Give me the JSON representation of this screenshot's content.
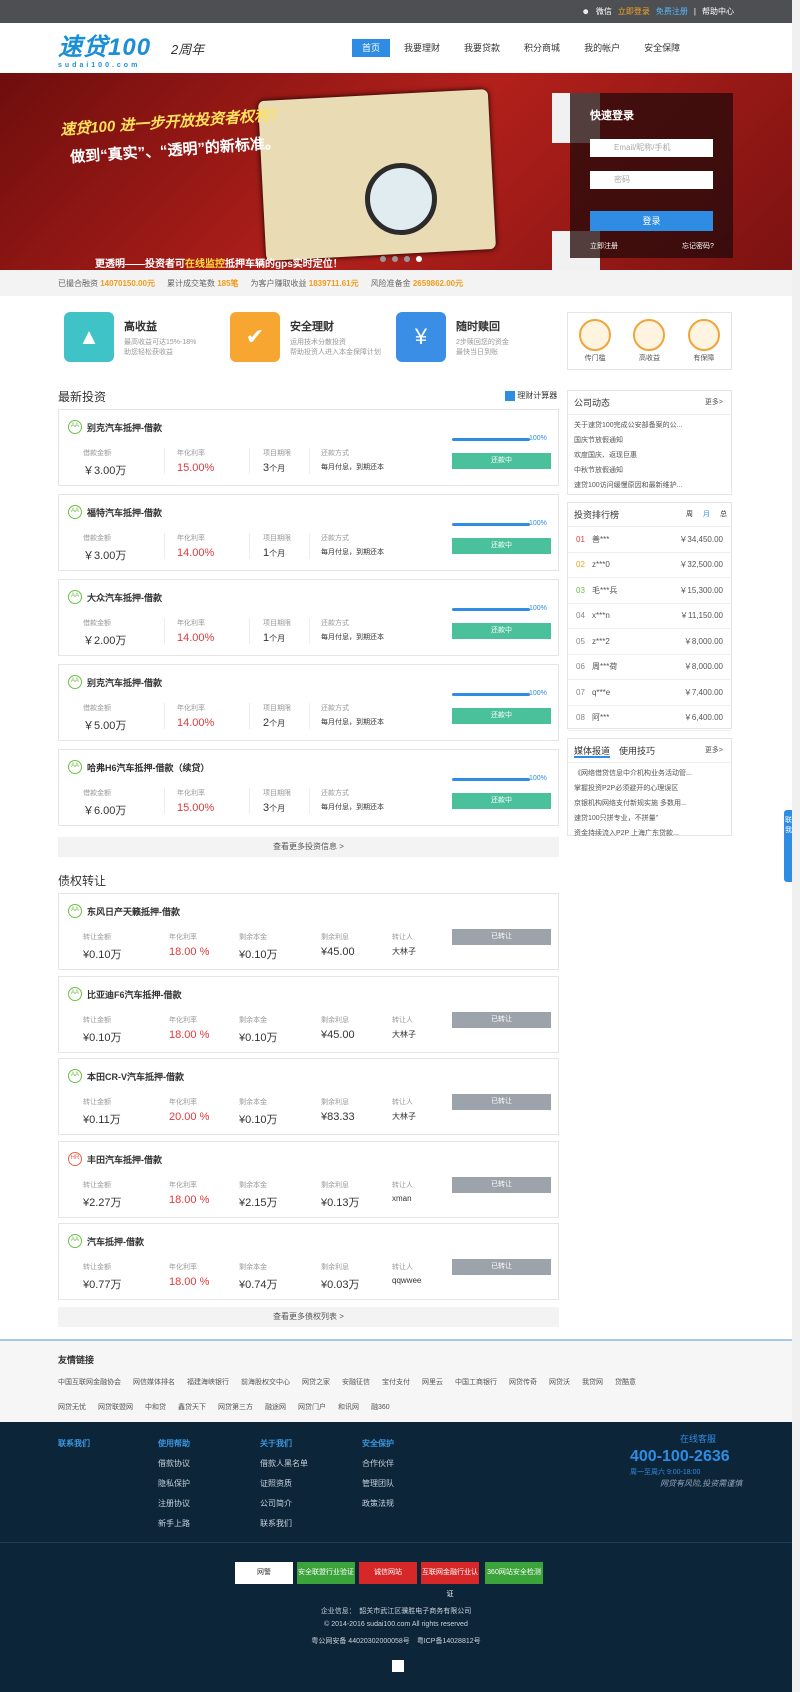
{
  "topbar": {
    "weixin": "微信",
    "login": "立即登录",
    "register": "免费注册",
    "help": "帮助中心"
  },
  "header": {
    "logo": "速贷100",
    "logo_sub": "sudai100.com",
    "anniversary": "2周年",
    "nav": [
      "首页",
      "我要理财",
      "我要贷款",
      "积分商城",
      "我的帐户",
      "安全保障"
    ]
  },
  "banner": {
    "line1": "速贷100 进一步开放投资者权利！",
    "line2": "做到“真实”、“透明”的新标准。",
    "line3a": "更透明——投资者可",
    "line3b": "在线监控",
    "line3c": "抵押车辆的gps实时定位！",
    "login_title": "快速登录",
    "user_ph": "Email/昵称/手机",
    "pwd_ph": "密码",
    "login_btn": "登录",
    "reg_link": "立即注册",
    "forgot": "忘记密码?"
  },
  "stats": [
    {
      "label": "已撮合融资",
      "value": "14070150.00元"
    },
    {
      "label": "累计成交笔数",
      "value": "185笔"
    },
    {
      "label": "为客户赚取收益",
      "value": "1839711.61元"
    },
    {
      "label": "风险准备金",
      "value": "2659862.00元"
    }
  ],
  "features": [
    {
      "title": "高收益",
      "d1": "最高收益可达15%-18%",
      "d2": "助您轻松获收益"
    },
    {
      "title": "安全理财",
      "d1": "运用技术分散投资",
      "d2": "帮助投资人进入本金保障计划"
    },
    {
      "title": "随时赎回",
      "d1": "2步赎回您的资金",
      "d2": "最快当日到账"
    }
  ],
  "badges": [
    "传门槛",
    "高收益",
    "有保障"
  ],
  "invest": {
    "title": "最新投资",
    "calc": "理财计算器",
    "more": "查看更多投资信息 >",
    "labels": {
      "amount": "借款金额",
      "rate": "年化利率",
      "term": "项目期限",
      "repay": "还款方式"
    },
    "items": [
      {
        "name": "别克汽车抵押-借款",
        "amount": "￥3.00万",
        "rate": "15.00%",
        "term": "3",
        "unit": "个月",
        "repay": "每月付息，到期还本",
        "pct": "100%",
        "status": "还款中"
      },
      {
        "name": "福特汽车抵押-借款",
        "amount": "￥3.00万",
        "rate": "14.00%",
        "term": "1",
        "unit": "个月",
        "repay": "每月付息，到期还本",
        "pct": "100%",
        "status": "还款中"
      },
      {
        "name": "大众汽车抵押-借款",
        "amount": "￥2.00万",
        "rate": "14.00%",
        "term": "1",
        "unit": "个月",
        "repay": "每月付息，到期还本",
        "pct": "100%",
        "status": "还款中"
      },
      {
        "name": "别克汽车抵押-借款",
        "amount": "￥5.00万",
        "rate": "14.00%",
        "term": "2",
        "unit": "个月",
        "repay": "每月付息，到期还本",
        "pct": "100%",
        "status": "还款中"
      },
      {
        "name": "哈弗H6汽车抵押-借款（续贷）",
        "amount": "￥6.00万",
        "rate": "15.00%",
        "term": "3",
        "unit": "个月",
        "repay": "每月付息，到期还本",
        "pct": "100%",
        "status": "还款中"
      }
    ]
  },
  "debt": {
    "title": "债权转让",
    "more": "查看更多债权列表 >",
    "labels": {
      "amount": "转让金额",
      "rate": "年化利率",
      "principal": "剩余本金",
      "interest": "剩余利息",
      "by": "转让人"
    },
    "items": [
      {
        "tag": "AA",
        "name": "东风日产天籁抵押-借款",
        "amount": "¥0.10万",
        "rate": "18.00 %",
        "principal": "¥0.10万",
        "interest": "¥45.00",
        "by": "大林子",
        "status": "已转让"
      },
      {
        "tag": "AA",
        "name": "比亚迪F6汽车抵押-借款",
        "amount": "¥0.10万",
        "rate": "18.00 %",
        "principal": "¥0.10万",
        "interest": "¥45.00",
        "by": "大林子",
        "status": "已转让"
      },
      {
        "tag": "AA",
        "name": "本田CR-V汽车抵押-借款",
        "amount": "¥0.11万",
        "rate": "20.00 %",
        "principal": "¥0.10万",
        "interest": "¥83.33",
        "by": "大林子",
        "status": "已转让"
      },
      {
        "tag": "HR",
        "name": "丰田汽车抵押-借款",
        "amount": "¥2.27万",
        "rate": "18.00 %",
        "principal": "¥2.15万",
        "interest": "¥0.13万",
        "by": "xman",
        "status": "已转让"
      },
      {
        "tag": "AA",
        "name": "汽车抵押-借款",
        "amount": "¥0.77万",
        "rate": "18.00 %",
        "principal": "¥0.74万",
        "interest": "¥0.03万",
        "by": "qqwwee",
        "status": "已转让"
      }
    ]
  },
  "news": {
    "title": "公司动态",
    "more": "更多>",
    "items": [
      "关于速贷100完成公安部备案的公...",
      "国庆节放假通知",
      "欢度国庆、返现巨惠",
      "中秋节放假通知",
      "速贷100访问缓慢原因和最新维护..."
    ]
  },
  "rank": {
    "title": "投资排行榜",
    "tabs": [
      "周",
      "月",
      "总"
    ],
    "items": [
      {
        "n": "01",
        "u": "善***",
        "a": "￥34,450.00"
      },
      {
        "n": "02",
        "u": "z***0",
        "a": "￥32,500.00"
      },
      {
        "n": "03",
        "u": "毛***兵",
        "a": "￥15,300.00"
      },
      {
        "n": "04",
        "u": "x***n",
        "a": "￥11,150.00"
      },
      {
        "n": "05",
        "u": "z***2",
        "a": "￥8,000.00"
      },
      {
        "n": "06",
        "u": "周***荷",
        "a": "￥8,000.00"
      },
      {
        "n": "07",
        "u": "q***e",
        "a": "￥7,400.00"
      },
      {
        "n": "08",
        "u": "阿***",
        "a": "￥6,400.00"
      }
    ]
  },
  "media": {
    "tab1": "媒体报道",
    "tab2": "使用技巧",
    "more": "更多>",
    "items": [
      "《网络借贷信息中介机构业务活动管...",
      "掌握投资P2P必须避开的心理误区",
      "京银机构网络支付新规实施 多数用...",
      "速贷100只拼专业，不拼量”",
      "资金持续流入P2P 上海广东贷款..."
    ]
  },
  "float": "联系我们",
  "friends": {
    "title": "友情链接",
    "row1": [
      "中国互联网金融协会",
      "网信媒体排名",
      "福建海峡银行",
      "前海股权交中心",
      "网贷之家",
      "安融征信",
      "宝付支付",
      "网里云",
      "中国工商银行",
      "网贷传奇",
      "网贷沃",
      "我贷网",
      "贷酷意"
    ],
    "row2": [
      "网贷无忧",
      "网贷联盟网",
      "中和贷",
      "鑫贷天下",
      "网贷第三方",
      "融途网",
      "网贷门户",
      "和讯网",
      "融360"
    ]
  },
  "footer": {
    "cols": [
      {
        "h": "联系我们",
        "items": []
      },
      {
        "h": "使用帮助",
        "items": [
          "借款协议",
          "隐私保护",
          "注册协议",
          "新手上路"
        ]
      },
      {
        "h": "关于我们",
        "items": [
          "借款人黑名单",
          "证照资质",
          "公司简介",
          "联系我们"
        ]
      },
      {
        "h": "安全保护",
        "items": [
          "合作伙伴",
          "管理团队",
          "政策法规"
        ]
      }
    ],
    "service": "在线客服",
    "tel": "400-100-2636",
    "hours": "周一至周六 9:00-18:00",
    "slogan": "网贷有风险,投资需谨慎",
    "certs": [
      "网警",
      "安全联盟行业验证",
      "诚信网站",
      "互联网金融行业认证",
      "360网站安全检测"
    ],
    "company": "企业信息：　韶关市武江区骥胜电子商务有限公司",
    "copyright": "© 2014-2016 sudai100.com All rights reserved",
    "icp1": "粤公网安备 44020302000058号",
    "icp2": "粤ICP备14028812号"
  }
}
